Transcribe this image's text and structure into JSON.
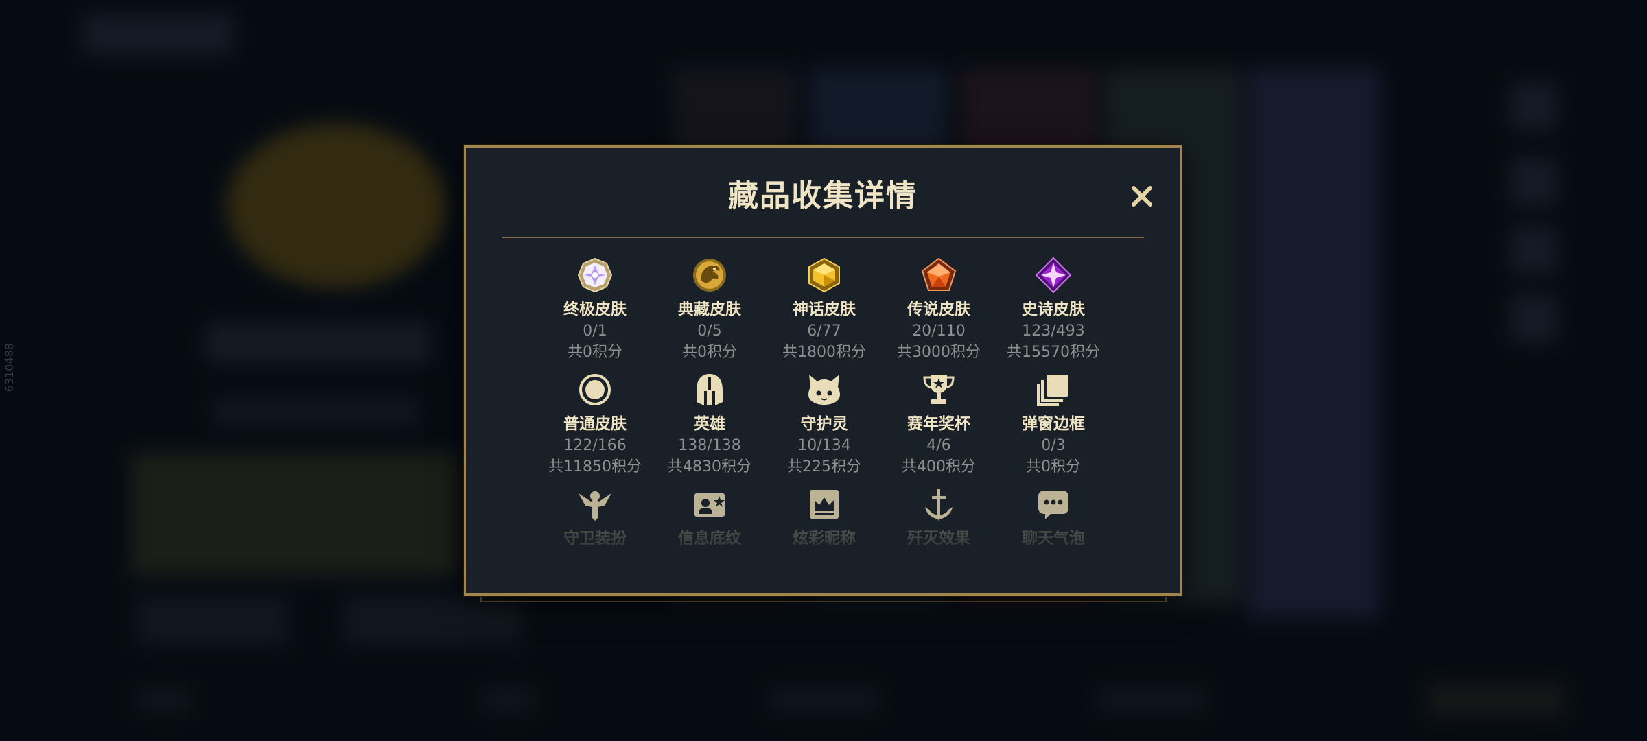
{
  "modal": {
    "title": "藏品收集详情",
    "close_icon": "close-icon",
    "rows": [
      [
        {
          "name": "终极皮肤",
          "count": "0/1",
          "points": "共0积分",
          "icon": "ultimate-gem-icon"
        },
        {
          "name": "典藏皮肤",
          "count": "0/5",
          "points": "共0积分",
          "icon": "dragon-emblem-icon"
        },
        {
          "name": "神话皮肤",
          "count": "6/77",
          "points": "共1800积分",
          "icon": "gold-hexagon-gem-icon"
        },
        {
          "name": "传说皮肤",
          "count": "20/110",
          "points": "共3000积分",
          "icon": "orange-pentagon-gem-icon"
        },
        {
          "name": "史诗皮肤",
          "count": "123/493",
          "points": "共15570积分",
          "icon": "purple-diamond-gem-icon"
        }
      ],
      [
        {
          "name": "普通皮肤",
          "count": "122/166",
          "points": "共11850积分",
          "icon": "ring-icon"
        },
        {
          "name": "英雄",
          "count": "138/138",
          "points": "共4830积分",
          "icon": "helmet-icon"
        },
        {
          "name": "守护灵",
          "count": "10/134",
          "points": "共225积分",
          "icon": "pet-face-icon"
        },
        {
          "name": "赛年奖杯",
          "count": "4/6",
          "points": "共400积分",
          "icon": "trophy-icon"
        },
        {
          "name": "弹窗边框",
          "count": "0/3",
          "points": "共0积分",
          "icon": "stacked-frames-icon"
        }
      ],
      [
        {
          "name": "守卫装扮",
          "icon": "ward-icon"
        },
        {
          "name": "信息底纹",
          "icon": "profile-card-icon"
        },
        {
          "name": "炫彩昵称",
          "icon": "crown-badge-icon"
        },
        {
          "name": "歼灭效果",
          "icon": "anchor-sword-icon"
        },
        {
          "name": "聊天气泡",
          "icon": "chat-bubble-icon"
        }
      ]
    ]
  },
  "side_text": "6310488",
  "colors": {
    "gold_border": "#a3864d",
    "title_text": "#efe4c4",
    "muted_text": "#8e9090",
    "panel_bg": "#192027"
  }
}
